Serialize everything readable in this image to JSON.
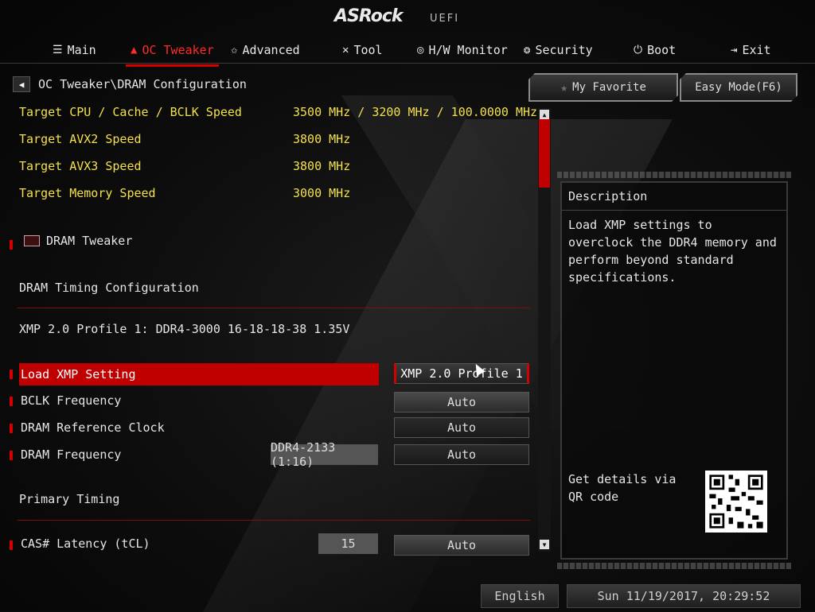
{
  "header": {
    "logo": "ASRock",
    "badge": "UEFI"
  },
  "nav": {
    "tabs": [
      {
        "label": "Main",
        "icon": "list-icon",
        "glyph": "☰",
        "active": false
      },
      {
        "label": "OC Tweaker",
        "icon": "flame-icon",
        "glyph": "🔥",
        "active": true
      },
      {
        "label": "Advanced",
        "icon": "star-icon",
        "glyph": "✩",
        "active": false
      },
      {
        "label": "Tool",
        "icon": "tools-icon",
        "glyph": "✕",
        "active": false
      },
      {
        "label": "H/W Monitor",
        "icon": "monitor-icon",
        "glyph": "◎",
        "active": false
      },
      {
        "label": "Security",
        "icon": "shield-icon",
        "glyph": "❂",
        "active": false
      },
      {
        "label": "Boot",
        "icon": "power-icon",
        "glyph": "⏻",
        "active": false
      },
      {
        "label": "Exit",
        "icon": "exit-icon",
        "glyph": "⇥",
        "active": false
      }
    ]
  },
  "breadcrumb": {
    "path": "OC Tweaker\\DRAM Configuration"
  },
  "buttons": {
    "favorite": "My Favorite",
    "easy_mode": "Easy Mode(F6)"
  },
  "targets": [
    {
      "label": "Target CPU / Cache / BCLK Speed",
      "value": "3500 MHz / 3200 MHz / 100.0000 MHz"
    },
    {
      "label": "Target AVX2 Speed",
      "value": "3800 MHz"
    },
    {
      "label": "Target AVX3 Speed",
      "value": "3800 MHz"
    },
    {
      "label": "Target Memory Speed",
      "value": "3000 MHz"
    }
  ],
  "section": {
    "dram_tweaker": "DRAM Tweaker",
    "dram_timing": "DRAM Timing Configuration",
    "xmp_info": "XMP 2.0 Profile 1: DDR4-3000 16-18-18-38 1.35V",
    "primary_timing": "Primary Timing"
  },
  "settings": [
    {
      "label": "Load XMP Setting",
      "current": "",
      "option": "XMP 2.0 Profile 1"
    },
    {
      "label": "BCLK Frequency",
      "current": "",
      "option": "Auto"
    },
    {
      "label": "DRAM Reference Clock",
      "current": "",
      "option": "Auto"
    },
    {
      "label": "DRAM Frequency",
      "current": "DDR4-2133 (1:16)",
      "option": "Auto"
    },
    {
      "label": "CAS# Latency (tCL)",
      "current": "15",
      "option": "Auto"
    }
  ],
  "description": {
    "title": "Description",
    "text": "Load XMP settings to overclock the DDR4 memory and perform beyond standard specifications.",
    "qr_text": "Get details via QR code"
  },
  "footer": {
    "language": "English",
    "datetime": "Sun 11/19/2017, 20:29:52"
  },
  "colors": {
    "accent": "#d40000",
    "highlight": "#f4e04a"
  }
}
